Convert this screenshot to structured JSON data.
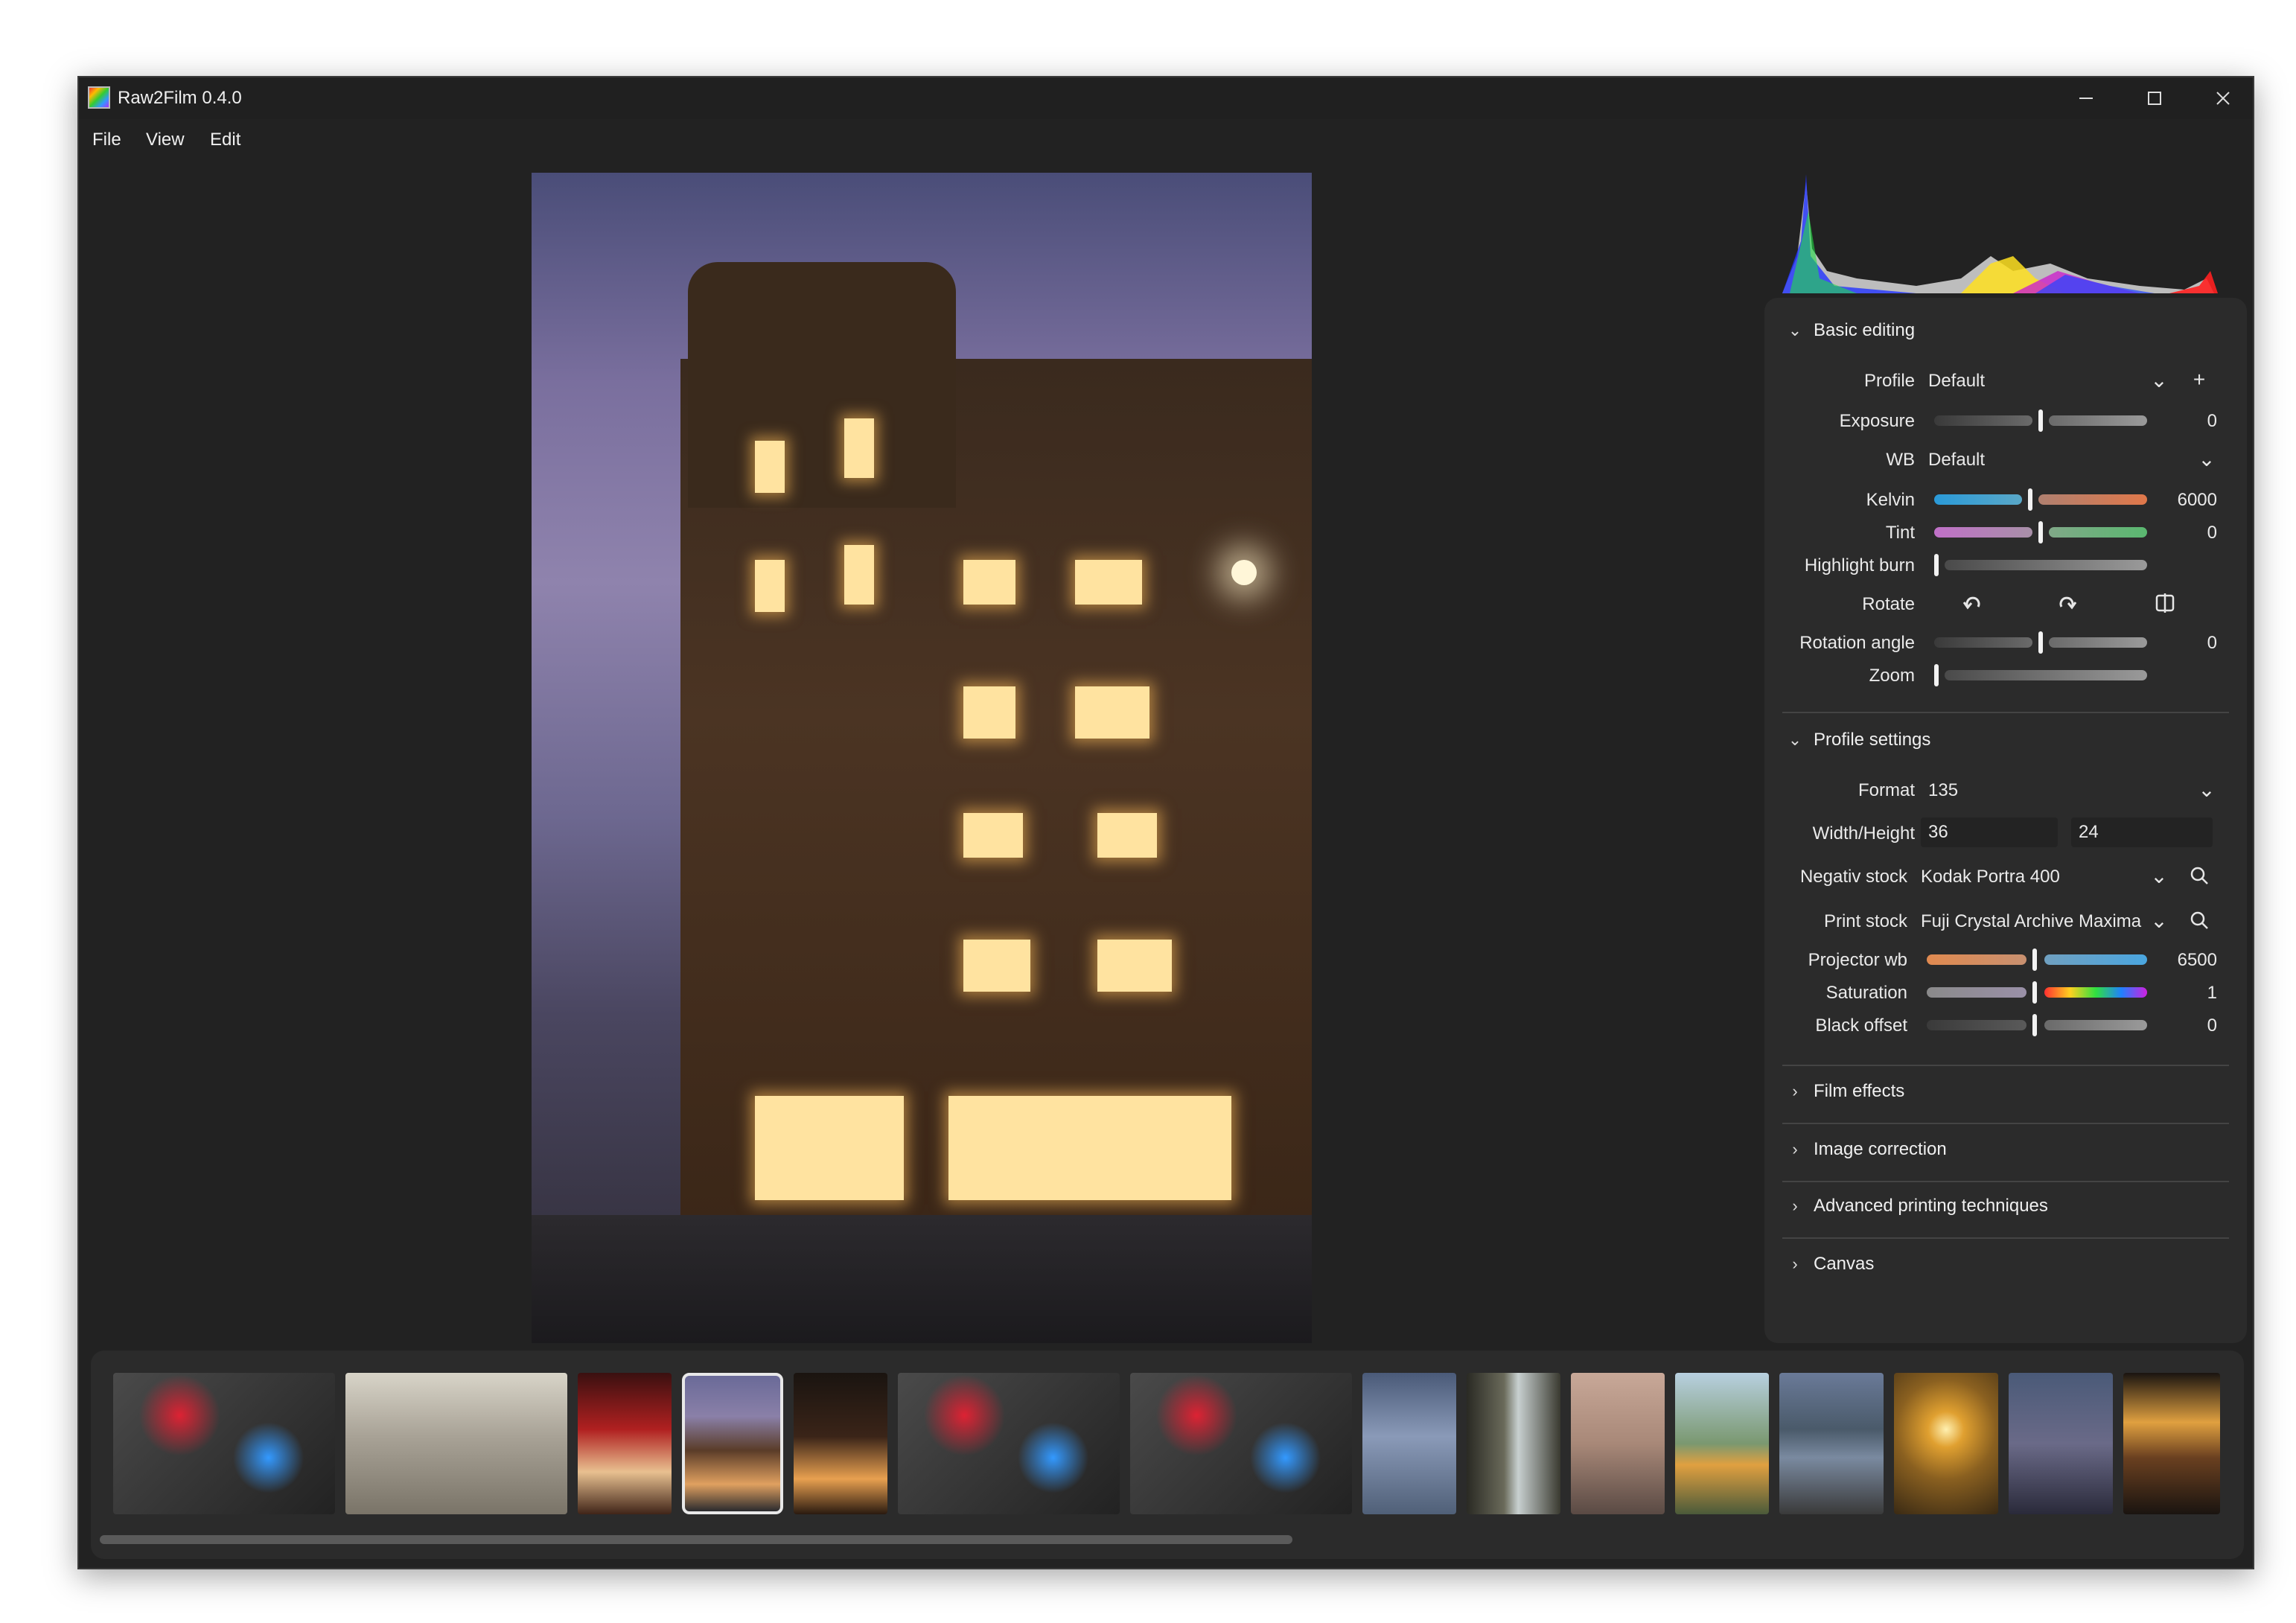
{
  "window": {
    "title": "Raw2Film 0.4.0"
  },
  "menu": {
    "file": "File",
    "view": "View",
    "edit": "Edit"
  },
  "icons": {
    "minimize": "minimize-icon",
    "maximize": "maximize-icon",
    "close": "close-icon",
    "chevron_down": "chevron-down-icon",
    "chevron_right": "chevron-right-icon",
    "plus": "plus-icon",
    "search": "search-icon",
    "rotate_left": "rotate-left-icon",
    "rotate_right": "rotate-right-icon",
    "flip": "flip-horizontal-icon"
  },
  "basic_editing": {
    "title": "Basic editing",
    "profile": {
      "label": "Profile",
      "value": "Default"
    },
    "exposure": {
      "label": "Exposure",
      "value": "0",
      "level": 0.5
    },
    "wb": {
      "label": "WB",
      "value": "Default"
    },
    "kelvin": {
      "label": "Kelvin",
      "value": "6000",
      "level": 0.44
    },
    "tint": {
      "label": "Tint",
      "value": "0",
      "level": 0.5
    },
    "highlight_burn": {
      "label": "Highlight burn",
      "level": 0.0
    },
    "rotate": {
      "label": "Rotate"
    },
    "rotation_angle": {
      "label": "Rotation angle",
      "value": "0",
      "level": 0.5
    },
    "zoom": {
      "label": "Zoom",
      "level": 0.0
    }
  },
  "profile_settings": {
    "title": "Profile settings",
    "format": {
      "label": "Format",
      "value": "135"
    },
    "width_height": {
      "label": "Width/Height",
      "width": "36",
      "height": "24"
    },
    "negativ_stock": {
      "label": "Negativ stock",
      "value": "Kodak Portra 400"
    },
    "print_stock": {
      "label": "Print stock",
      "value": "Fuji Crystal Archive Maxima"
    },
    "projector_wb": {
      "label": "Projector wb",
      "value": "6500",
      "level": 0.48
    },
    "saturation": {
      "label": "Saturation",
      "value": "1",
      "level": 0.48
    },
    "black_offset": {
      "label": "Black offset",
      "value": "0",
      "level": 0.48
    }
  },
  "collapsed_sections": {
    "film_effects": "Film effects",
    "image_correction": "Image correction",
    "advanced_printing": "Advanced printing techniques",
    "canvas": "Canvas"
  },
  "filmstrip": {
    "selected_index": 3,
    "scroll_fraction": 0.56,
    "thumbnails": [
      {
        "kind": "color-chart"
      },
      {
        "kind": "museum-hall"
      },
      {
        "kind": "red-shrine"
      },
      {
        "kind": "night-building"
      },
      {
        "kind": "night-street"
      },
      {
        "kind": "color-chart"
      },
      {
        "kind": "color-chart"
      },
      {
        "kind": "cloudy-sky"
      },
      {
        "kind": "waterfall-cliff"
      },
      {
        "kind": "sunset-beach"
      },
      {
        "kind": "hiker-mountain"
      },
      {
        "kind": "river-valley"
      },
      {
        "kind": "golden-sun"
      },
      {
        "kind": "portrait-dusk"
      },
      {
        "kind": "night-lights"
      }
    ]
  },
  "colors": {
    "window_bg": "#222222",
    "panel_bg": "#2b2b2b",
    "accent_white": "#f2f2f2",
    "kelvin_blue": "#3aa0d8",
    "kelvin_orange": "#e0784a",
    "tint_magenta": "#c070c8",
    "tint_green": "#5ab870",
    "projector_orange": "#e08a50",
    "projector_blue": "#4aa6e0"
  }
}
